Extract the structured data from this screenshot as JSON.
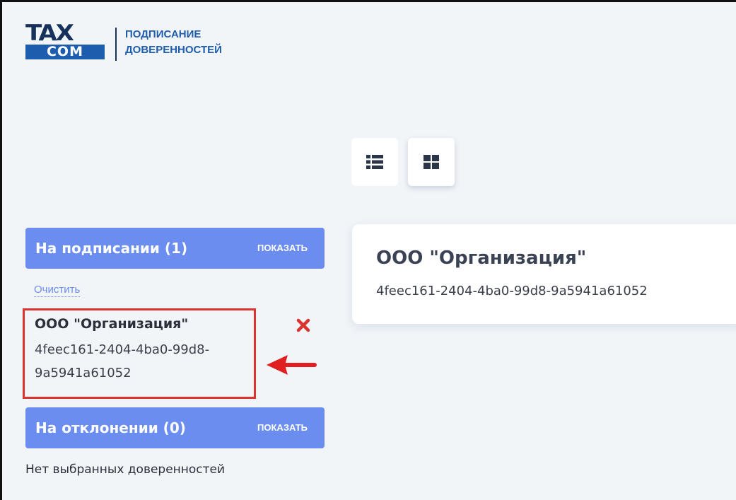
{
  "header": {
    "logo_top": "TAX",
    "logo_bottom": "COM",
    "subtitle_line1": "ПОДПИСАНИЕ",
    "subtitle_line2": "ДОВЕРЕННОСТЕЙ"
  },
  "view_toggle": {
    "list_icon": "list-icon",
    "tile_icon": "grid-icon",
    "active": "tile"
  },
  "sidebar": {
    "signing": {
      "title": "На подписании (1)",
      "show_label": "ПОКАЗАТЬ"
    },
    "clear_label": "Очистить",
    "selected_items": [
      {
        "name": "ООО \"Организация\"",
        "id_line1": "4feec161-2404-4ba0-99d8-",
        "id_line2": "9a5941a61052",
        "remove_icon": "close-icon"
      }
    ],
    "rejecting": {
      "title": "На отклонении (0)",
      "show_label": "ПОКАЗАТЬ"
    },
    "empty_text": "Нет выбранных доверенностей"
  },
  "cards": [
    {
      "title": "ООО \"Организация\"",
      "id": "4feec161-2404-4ba0-99d8-9a5941a61052"
    }
  ],
  "colors": {
    "accent": "#6b8df0",
    "highlight": "#d9342f",
    "background": "#f2f5f8",
    "brand": "#1e5dae"
  }
}
